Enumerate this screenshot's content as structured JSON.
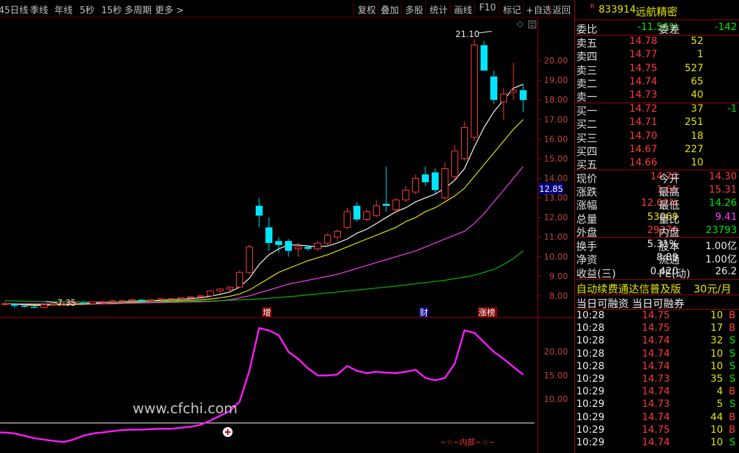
{
  "toolbar": {
    "periods": [
      "45日线",
      "季线",
      "年线",
      "5秒",
      "15秒",
      "多周期",
      "更多 >"
    ],
    "buttons": [
      "复权",
      "叠加",
      "多股",
      "统计",
      "画线",
      "F10",
      "标记",
      "+自选",
      "返回"
    ]
  },
  "chart": {
    "price_axis": [
      "20.00",
      "19.00",
      "18.00",
      "17.00",
      "16.00",
      "15.00",
      "14.00",
      "13.00",
      "12.00",
      "11.00",
      "10.00",
      "9.00",
      "8.00"
    ],
    "current_price_tag": "12.85",
    "high_label": "21.10",
    "low_label": "7.35",
    "event_markers": [
      "增",
      "财",
      "涨榜"
    ],
    "indicator_axis": [
      "20.00",
      "15.00",
      "10.00"
    ],
    "watermark": "www.cfchi.com",
    "indicator_caption": "~☆~内部~☆~"
  },
  "chart_data": {
    "type": "candlestick",
    "title": "",
    "ylim": [
      7.0,
      21.5
    ],
    "candles": [
      [
        7.6,
        7.7,
        7.5,
        7.6
      ],
      [
        7.6,
        7.6,
        7.4,
        7.5
      ],
      [
        7.5,
        7.6,
        7.4,
        7.45
      ],
      [
        7.45,
        7.5,
        7.35,
        7.4
      ],
      [
        7.4,
        7.6,
        7.4,
        7.55
      ],
      [
        7.55,
        7.6,
        7.5,
        7.6
      ],
      [
        7.6,
        7.7,
        7.55,
        7.6
      ],
      [
        7.6,
        7.7,
        7.55,
        7.65
      ],
      [
        7.65,
        7.7,
        7.6,
        7.6
      ],
      [
        7.6,
        7.7,
        7.55,
        7.7
      ],
      [
        7.7,
        7.75,
        7.6,
        7.7
      ],
      [
        7.7,
        7.8,
        7.65,
        7.75
      ],
      [
        7.75,
        7.8,
        7.7,
        7.75
      ],
      [
        7.75,
        7.85,
        7.7,
        7.8
      ],
      [
        7.8,
        7.85,
        7.7,
        7.75
      ],
      [
        7.75,
        7.85,
        7.7,
        7.8
      ],
      [
        7.8,
        7.9,
        7.75,
        7.85
      ],
      [
        7.85,
        7.9,
        7.8,
        7.85
      ],
      [
        7.85,
        7.9,
        7.8,
        7.9
      ],
      [
        7.9,
        8.0,
        7.85,
        7.95
      ],
      [
        7.95,
        8.05,
        7.9,
        8.0
      ],
      [
        8.0,
        8.3,
        7.95,
        8.25
      ],
      [
        8.25,
        8.4,
        8.1,
        8.35
      ],
      [
        8.35,
        8.5,
        8.2,
        8.45
      ],
      [
        8.45,
        9.3,
        8.4,
        9.2
      ],
      [
        9.2,
        10.6,
        9.1,
        10.5
      ],
      [
        12.6,
        13.0,
        11.5,
        12.1
      ],
      [
        11.5,
        12.0,
        10.3,
        10.7
      ],
      [
        10.8,
        11.0,
        10.2,
        10.6
      ],
      [
        10.8,
        10.9,
        10.0,
        10.3
      ],
      [
        10.4,
        10.7,
        10.0,
        10.5
      ],
      [
        10.5,
        10.6,
        10.3,
        10.4
      ],
      [
        10.4,
        10.8,
        10.3,
        10.7
      ],
      [
        10.7,
        11.2,
        10.6,
        11.1
      ],
      [
        11.0,
        11.4,
        10.8,
        11.3
      ],
      [
        11.5,
        12.5,
        11.4,
        12.3
      ],
      [
        12.6,
        12.8,
        11.8,
        11.9
      ],
      [
        11.9,
        12.4,
        11.8,
        12.3
      ],
      [
        12.1,
        12.9,
        12.0,
        12.6
      ],
      [
        12.7,
        14.6,
        12.3,
        12.6
      ],
      [
        12.4,
        13.0,
        12.2,
        12.9
      ],
      [
        12.9,
        13.6,
        12.8,
        13.4
      ],
      [
        13.3,
        14.2,
        13.2,
        14.0
      ],
      [
        14.2,
        14.6,
        13.6,
        13.8
      ],
      [
        14.3,
        14.5,
        13.2,
        13.4
      ],
      [
        13.0,
        14.8,
        12.9,
        14.5
      ],
      [
        14.1,
        15.7,
        13.9,
        15.4
      ],
      [
        15.0,
        16.9,
        14.9,
        16.6
      ],
      [
        16.1,
        21.1,
        15.9,
        20.8
      ],
      [
        20.8,
        21.0,
        19.5,
        19.5
      ],
      [
        19.2,
        19.5,
        17.8,
        18.0
      ],
      [
        17.9,
        18.6,
        17.0,
        18.3
      ],
      [
        18.4,
        19.9,
        18.0,
        18.5
      ],
      [
        18.5,
        18.8,
        17.4,
        18.0
      ]
    ],
    "ma_series": [
      {
        "color": "#ffffff",
        "values": [
          7.6,
          7.58,
          7.55,
          7.52,
          7.52,
          7.55,
          7.57,
          7.6,
          7.62,
          7.63,
          7.66,
          7.68,
          7.7,
          7.73,
          7.74,
          7.76,
          7.78,
          7.8,
          7.83,
          7.86,
          7.9,
          7.98,
          8.08,
          8.2,
          8.45,
          8.9,
          9.6,
          10.1,
          10.4,
          10.6,
          10.6,
          10.55,
          10.5,
          10.55,
          10.7,
          10.9,
          11.2,
          11.4,
          11.7,
          12.0,
          12.3,
          12.5,
          12.8,
          13.0,
          13.2,
          13.5,
          13.9,
          14.5,
          15.6,
          16.6,
          17.4,
          18.0,
          18.6,
          18.8
        ]
      },
      {
        "color": "#e8e800",
        "values": [
          7.6,
          7.6,
          7.58,
          7.56,
          7.55,
          7.55,
          7.55,
          7.56,
          7.57,
          7.58,
          7.6,
          7.62,
          7.64,
          7.66,
          7.68,
          7.7,
          7.72,
          7.74,
          7.76,
          7.78,
          7.8,
          7.84,
          7.9,
          7.98,
          8.1,
          8.3,
          8.6,
          8.9,
          9.2,
          9.4,
          9.6,
          9.8,
          9.95,
          10.1,
          10.3,
          10.5,
          10.7,
          10.9,
          11.1,
          11.3,
          11.5,
          11.8,
          12.0,
          12.3,
          12.5,
          12.8,
          13.1,
          13.5,
          14.1,
          14.7,
          15.3,
          15.9,
          16.5,
          17.0
        ]
      },
      {
        "color": "#ff40ff",
        "values": [
          7.6,
          7.6,
          7.6,
          7.6,
          7.6,
          7.6,
          7.6,
          7.6,
          7.6,
          7.6,
          7.6,
          7.6,
          7.62,
          7.63,
          7.64,
          7.65,
          7.66,
          7.67,
          7.68,
          7.69,
          7.7,
          7.72,
          7.75,
          7.8,
          7.9,
          8.0,
          8.15,
          8.3,
          8.45,
          8.6,
          8.7,
          8.8,
          8.9,
          9.0,
          9.1,
          9.25,
          9.4,
          9.55,
          9.7,
          9.85,
          10.0,
          10.15,
          10.3,
          10.5,
          10.7,
          10.9,
          11.1,
          11.3,
          11.7,
          12.2,
          12.8,
          13.4,
          14.0,
          14.6
        ]
      },
      {
        "color": "#00c000",
        "values": [
          7.75,
          7.74,
          7.73,
          7.72,
          7.71,
          7.7,
          7.7,
          7.7,
          7.69,
          7.69,
          7.69,
          7.69,
          7.69,
          7.69,
          7.7,
          7.7,
          7.7,
          7.7,
          7.71,
          7.72,
          7.73,
          7.74,
          7.76,
          7.78,
          7.8,
          7.82,
          7.85,
          7.88,
          7.92,
          7.96,
          8.0,
          8.05,
          8.1,
          8.15,
          8.2,
          8.25,
          8.3,
          8.35,
          8.4,
          8.45,
          8.5,
          8.56,
          8.62,
          8.68,
          8.74,
          8.8,
          8.88,
          8.96,
          9.06,
          9.2,
          9.35,
          9.6,
          9.9,
          10.3
        ]
      }
    ],
    "indicator": {
      "ylim": [
        0,
        25
      ],
      "reference": 5.0,
      "values": [
        3.0,
        2.8,
        2.3,
        1.8,
        1.5,
        1.2,
        1.0,
        1.5,
        2.3,
        2.8,
        3.0,
        3.3,
        3.5,
        3.6,
        3.6,
        3.7,
        3.8,
        3.8,
        4.0,
        4.2,
        4.6,
        5.5,
        6.5,
        7.5,
        9.5,
        16.0,
        25.0,
        24.5,
        23.5,
        20.0,
        18.5,
        16.5,
        15.0,
        15.0,
        15.2,
        17.0,
        16.0,
        15.5,
        15.8,
        15.6,
        15.5,
        15.8,
        16.2,
        14.5,
        14.0,
        14.5,
        17.5,
        24.5,
        24.0,
        22.0,
        20.0,
        18.5,
        16.8,
        15.2
      ]
    }
  },
  "panel": {
    "code_prefix": "R",
    "code": "833914",
    "name": "远航精密",
    "weibi_label": "委比",
    "weibi_value": "-11.56%",
    "weicha_label": "委差",
    "weicha_value": "-142",
    "asks": [
      {
        "label": "卖五",
        "price": "14.78",
        "vol": "52"
      },
      {
        "label": "卖四",
        "price": "14.77",
        "vol": "1"
      },
      {
        "label": "卖三",
        "price": "14.75",
        "vol": "527"
      },
      {
        "label": "卖二",
        "price": "14.74",
        "vol": "65"
      },
      {
        "label": "卖一",
        "price": "14.73",
        "vol": "40"
      }
    ],
    "bids": [
      {
        "label": "买一",
        "price": "14.72",
        "vol": "37",
        "chg": "-1"
      },
      {
        "label": "买二",
        "price": "14.71",
        "vol": "251",
        "chg": ""
      },
      {
        "label": "买三",
        "price": "14.70",
        "vol": "18",
        "chg": ""
      },
      {
        "label": "买四",
        "price": "14.67",
        "vol": "227",
        "chg": ""
      },
      {
        "label": "买五",
        "price": "14.66",
        "vol": "10",
        "chg": ""
      }
    ],
    "quote": [
      {
        "l1": "现价",
        "v1": "14.72",
        "l2": "今开",
        "v2": "14.30"
      },
      {
        "l1": "涨跌",
        "v1": "1.65",
        "l2": "最高",
        "v2": "15.31"
      },
      {
        "l1": "涨幅",
        "v1": "12.62%",
        "l2": "最低",
        "v2": "14.26"
      },
      {
        "l1": "总量",
        "v1": "53069",
        "l2": "量比",
        "v2": "9.41"
      },
      {
        "l1": "外盘",
        "v1": "29276",
        "l2": "内盘",
        "v2": "23793"
      }
    ],
    "fund": [
      {
        "l1": "换手",
        "v1": "5.31%",
        "l2": "股本",
        "v2": "1.00亿"
      },
      {
        "l1": "净资",
        "v1": "8.89",
        "l2": "流通",
        "v2": "1.00亿"
      },
      {
        "l1": "收益(三)",
        "v1": "0.420",
        "l2": "PE(动)",
        "v2": "26.2"
      }
    ],
    "promo": "自动续费通达信普及版",
    "promo_price": "30元/月",
    "margin_text": "当日可融资 当日可融券",
    "ticks": [
      {
        "time": "10:28",
        "price": "14.75",
        "vol": "10",
        "side": "B"
      },
      {
        "time": "10:28",
        "price": "14.75",
        "vol": "17",
        "side": "B"
      },
      {
        "time": "10:28",
        "price": "14.74",
        "vol": "32",
        "side": "S"
      },
      {
        "time": "10:28",
        "price": "14.74",
        "vol": "10",
        "side": "S"
      },
      {
        "time": "10:28",
        "price": "14.74",
        "vol": "10",
        "side": "S"
      },
      {
        "time": "10:29",
        "price": "14.73",
        "vol": "35",
        "side": "S"
      },
      {
        "time": "10:29",
        "price": "14.74",
        "vol": "4",
        "side": "B"
      },
      {
        "time": "10:29",
        "price": "14.73",
        "vol": "5",
        "side": "S"
      },
      {
        "time": "10:29",
        "price": "14.74",
        "vol": "44",
        "side": "B"
      },
      {
        "time": "10:29",
        "price": "14.75",
        "vol": "10",
        "side": "B"
      },
      {
        "time": "10:29",
        "price": "14.74",
        "vol": "10",
        "side": "S"
      }
    ]
  }
}
